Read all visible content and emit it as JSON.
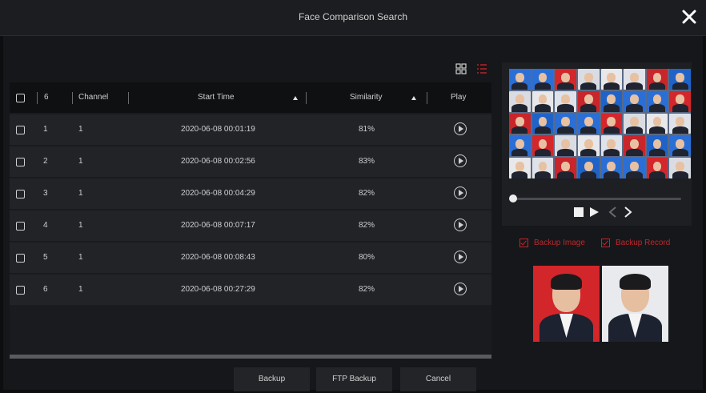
{
  "window": {
    "title": "Face Comparison Search"
  },
  "table": {
    "columns": {
      "count": "6",
      "channel": "Channel",
      "start_time": "Start Time",
      "similarity": "Similarity",
      "play": "Play"
    },
    "rows": [
      {
        "index": "1",
        "channel": "1",
        "start_time": "2020-06-08 00:01:19",
        "similarity": "81%"
      },
      {
        "index": "2",
        "channel": "1",
        "start_time": "2020-06-08 00:02:56",
        "similarity": "83%"
      },
      {
        "index": "3",
        "channel": "1",
        "start_time": "2020-06-08 00:04:29",
        "similarity": "82%"
      },
      {
        "index": "4",
        "channel": "1",
        "start_time": "2020-06-08 00:07:17",
        "similarity": "82%"
      },
      {
        "index": "5",
        "channel": "1",
        "start_time": "2020-06-08 00:08:43",
        "similarity": "80%"
      },
      {
        "index": "6",
        "channel": "1",
        "start_time": "2020-06-08 00:27:29",
        "similarity": "82%"
      }
    ]
  },
  "buttons": {
    "backup": "Backup",
    "ftp_backup": "FTP Backup",
    "cancel": "Cancel"
  },
  "options": {
    "backup_image": "Backup Image",
    "backup_record": "Backup Record"
  },
  "colors": {
    "accent": "#c0262b",
    "background": "#0d0e10",
    "row": "#222327"
  },
  "icons": [
    "close-icon",
    "grid-view-icon",
    "list-view-icon",
    "play-circle-icon",
    "stop-icon",
    "play-icon",
    "prev-icon",
    "next-icon"
  ]
}
